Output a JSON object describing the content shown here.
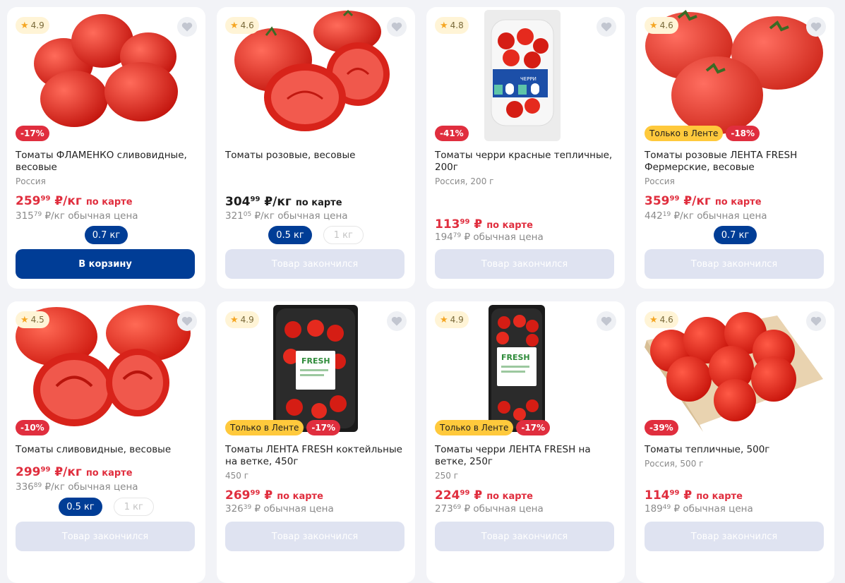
{
  "labels": {
    "card_suffix": "по карте",
    "regular_suffix": "обычная цена",
    "exclusive": "Только в Ленте"
  },
  "products": [
    {
      "rating": "4.9",
      "discount": "-17%",
      "title": "Томаты ФЛАМЕНКО сливовидные, весовые",
      "subtitle": "Россия",
      "card_price_int": "259",
      "card_price_dec": "99",
      "card_price_unit": "₽/кг",
      "regular_price_int": "315",
      "regular_price_dec": "79",
      "regular_price_unit": "₽/кг",
      "weight_selected": "0.7 кг",
      "button": "В корзину"
    },
    {
      "rating": "4.6",
      "title": "Томаты розовые, весовые",
      "card_price_int": "304",
      "card_price_dec": "99",
      "card_price_unit": "₽/кг",
      "regular_price_int": "321",
      "regular_price_dec": "05",
      "regular_price_unit": "₽/кг",
      "weight_selected": "0.5 кг",
      "weight_other": "1 кг",
      "button": "Товар закончился"
    },
    {
      "rating": "4.8",
      "discount": "-41%",
      "title": "Томаты черри красные тепличные, 200г",
      "subtitle": "Россия, 200 г",
      "card_price_int": "113",
      "card_price_dec": "99",
      "card_price_unit": "₽",
      "regular_price_int": "194",
      "regular_price_dec": "79",
      "regular_price_unit": "₽",
      "package_label": "ЧЕРРИ",
      "button": "Товар закончился"
    },
    {
      "rating": "4.6",
      "exclusive": true,
      "discount": "-18%",
      "title": "Томаты розовые ЛЕНТА FRESH Фермерские, весовые",
      "subtitle": "Россия",
      "card_price_int": "359",
      "card_price_dec": "99",
      "card_price_unit": "₽/кг",
      "regular_price_int": "442",
      "regular_price_dec": "19",
      "regular_price_unit": "₽/кг",
      "weight_selected": "0.7 кг",
      "button": "Товар закончился"
    },
    {
      "rating": "4.5",
      "discount": "-10%",
      "title": "Томаты сливовидные, весовые",
      "card_price_int": "299",
      "card_price_dec": "99",
      "card_price_unit": "₽/кг",
      "regular_price_int": "336",
      "regular_price_dec": "89",
      "regular_price_unit": "₽/кг",
      "weight_selected": "0.5 кг",
      "weight_other": "1 кг",
      "button": "Товар закончился"
    },
    {
      "rating": "4.9",
      "exclusive": true,
      "discount": "-17%",
      "title": "Томаты ЛЕНТА FRESH коктейльные на ветке, 450г",
      "subtitle": "450 г",
      "card_price_int": "269",
      "card_price_dec": "99",
      "card_price_unit": "₽",
      "regular_price_int": "326",
      "regular_price_dec": "39",
      "regular_price_unit": "₽",
      "package_label": "FRESH",
      "button": "Товар закончился"
    },
    {
      "rating": "4.9",
      "exclusive": true,
      "discount": "-17%",
      "title": "Томаты черри ЛЕНТА FRESH на ветке, 250г",
      "subtitle": "250 г",
      "card_price_int": "224",
      "card_price_dec": "99",
      "card_price_unit": "₽",
      "regular_price_int": "273",
      "regular_price_dec": "69",
      "regular_price_unit": "₽",
      "package_label": "FRESH",
      "button": "Товар закончился"
    },
    {
      "rating": "4.6",
      "discount": "-39%",
      "title": "Томаты тепличные, 500г",
      "subtitle": "Россия, 500 г",
      "card_price_int": "114",
      "card_price_dec": "99",
      "card_price_unit": "₽",
      "regular_price_int": "189",
      "regular_price_dec": "49",
      "regular_price_unit": "₽",
      "button": "Товар закончился"
    }
  ],
  "colors": {
    "accent_blue": "#003d96",
    "discount_red": "#e02e3e",
    "exclusive_yellow": "#ffc93c",
    "disabled_button": "#dfe3f1"
  },
  "icons": {
    "rating": "star-icon",
    "favorite": "heart-icon"
  }
}
